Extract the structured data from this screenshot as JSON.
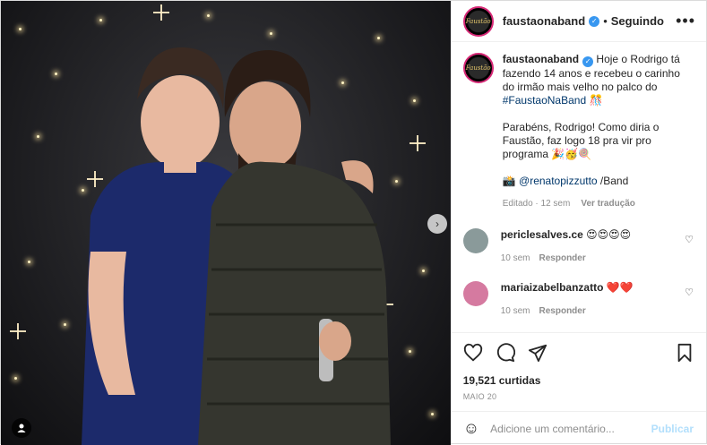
{
  "header": {
    "username": "faustaonaband",
    "separator": "•",
    "follow_label": "Seguindo",
    "more_glyph": "•••",
    "avatar_logo_text": "Faustão"
  },
  "caption": {
    "username": "faustaonaband",
    "text_1": " Hoje o Rodrigo tá fazendo 14 anos e recebeu o carinho do irmão mais velho no palco do ",
    "hashtag": "#FaustaoNaBand",
    "text_1_emoji": " 🎊",
    "text_2": "Parabéns, Rodrigo! Como diria o Faustão, faz logo 18 pra vir pro programa 🎉🥳🍭",
    "camera_emoji": "📸",
    "photo_credit": "@renatopizzutto",
    "credit_suffix": " /Band",
    "edited": "Editado · 12 sem",
    "translate": "Ver tradução"
  },
  "comments": [
    {
      "username": "periclesalves.ce",
      "text": "😍😍😍😍",
      "time": "10 sem",
      "reply": "Responder",
      "avatar_color": "#8a9a9a"
    },
    {
      "username": "mariaizabelbanzatto",
      "text": "❤️❤️",
      "time": "10 sem",
      "reply": "Responder",
      "avatar_color": "#d57aa0"
    }
  ],
  "post": {
    "likes": "19,521 curtidas",
    "date": "MAIO 20"
  },
  "composer": {
    "emoji_icon": "☺",
    "placeholder": "Adicione um comentário...",
    "publish_label": "Publicar"
  },
  "media": {
    "next_glyph": "›"
  },
  "colors": {
    "verified": "#3897f0",
    "link": "#00376b",
    "publish_disabled": "#b2dffc"
  }
}
